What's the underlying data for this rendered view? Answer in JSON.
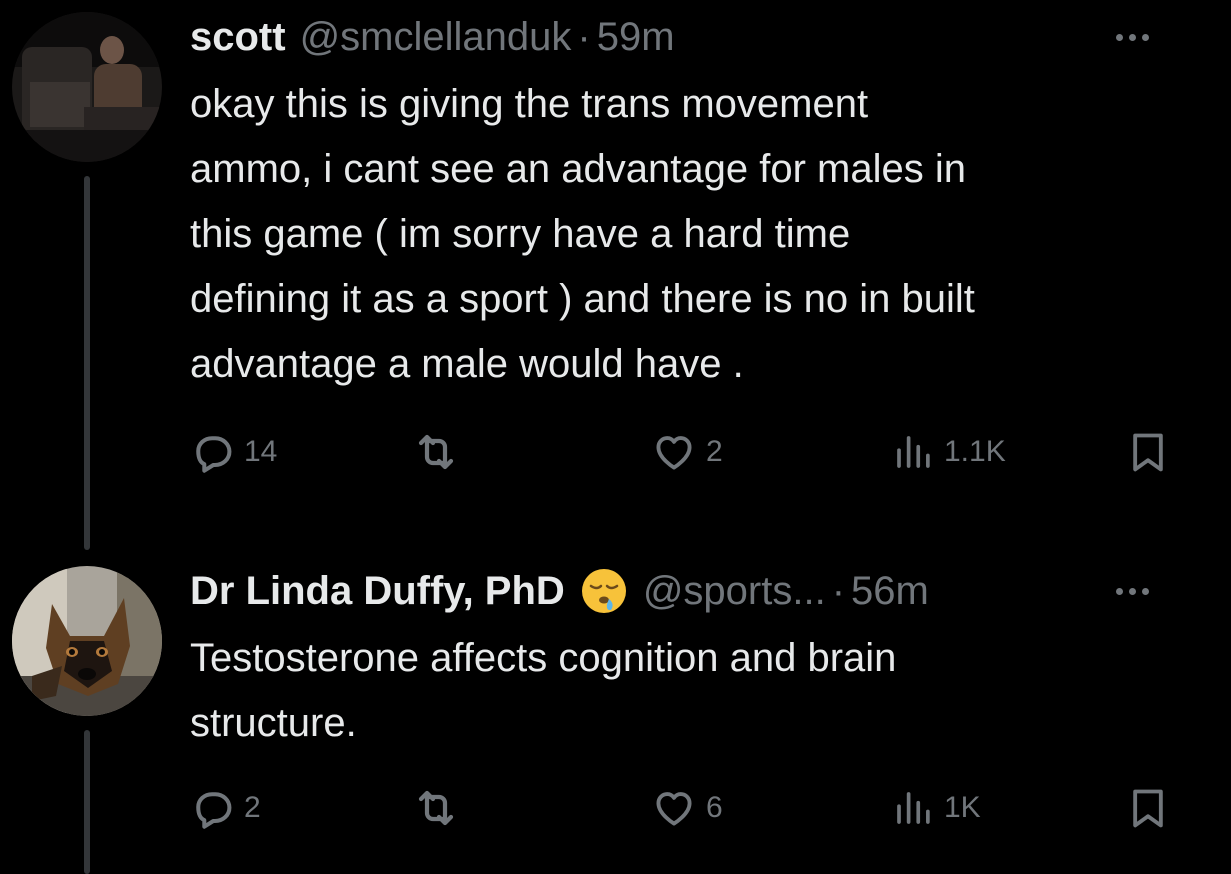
{
  "tweets": [
    {
      "name": "scott",
      "handle": "@smclellanduk",
      "separator": "·",
      "time": "59m",
      "text": "okay this is giving the trans movement ammo, i cant see an advantage for males in this game ( im sorry have a hard time defining it as a sport ) and there is no in built advantage a male would have .",
      "text_lines": [
        "okay this is giving the trans movement",
        "ammo, i cant see an advantage for males in",
        "this game ( im sorry have a hard time",
        "defining it as a sport ) and there is no in built",
        "advantage a male would have ."
      ],
      "replies": "14",
      "likes": "2",
      "views": "1.1K"
    },
    {
      "name": "Dr Linda Duffy, PhD",
      "name_emoji": "sleepy-face-emoji",
      "handle": "@sports...",
      "separator": "·",
      "time": "56m",
      "text": "Testosterone affects cognition and brain structure.",
      "text_lines": [
        "Testosterone affects cognition and brain",
        "structure."
      ],
      "replies": "2",
      "likes": "6",
      "views": "1K"
    }
  ],
  "icons": {
    "reply": "reply-icon",
    "retweet": "retweet-icon",
    "like": "heart-icon",
    "views": "views-icon",
    "bookmark": "bookmark-icon",
    "more": "more-icon"
  },
  "colors": {
    "background": "#000000",
    "text_primary": "#e7e9ea",
    "text_secondary": "#71767b",
    "thread_line": "#333639"
  }
}
